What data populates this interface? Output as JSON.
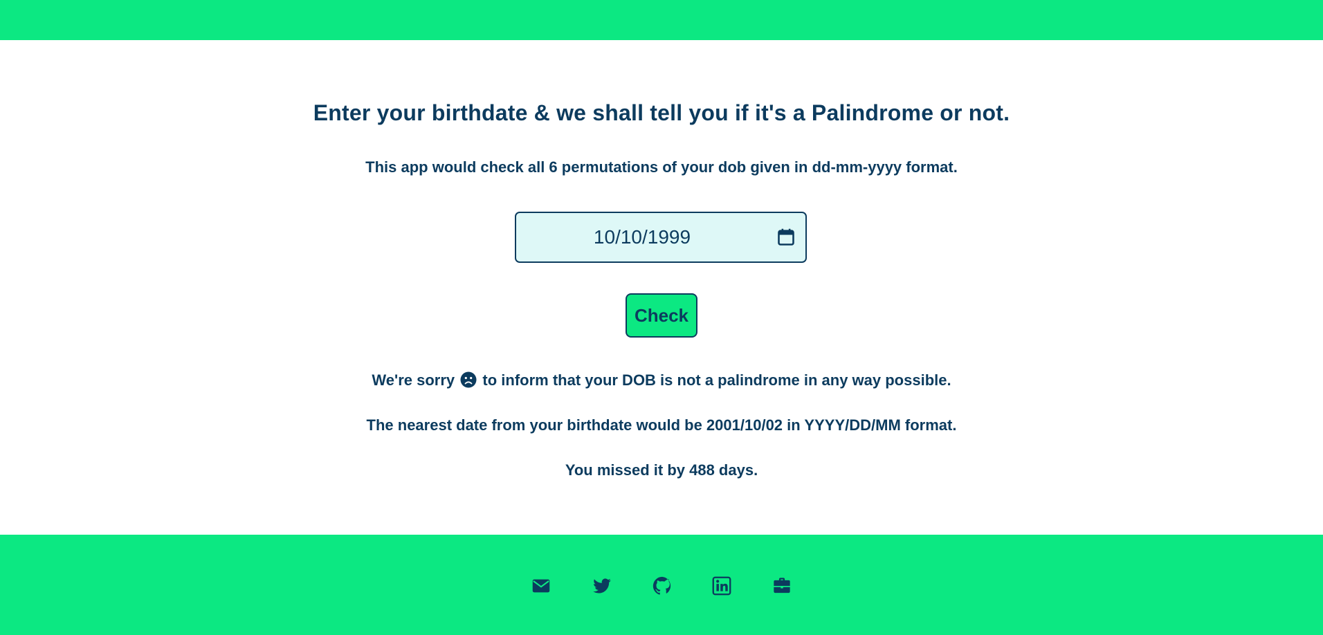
{
  "header": {
    "color": "#0ce882"
  },
  "main": {
    "title": "Enter your birthdate & we shall tell you if it's a Palindrome or not.",
    "subtitle": "This app would check all 6 permutations of your dob given in dd-mm-yyyy format.",
    "date_input": {
      "value": "10/10/1999",
      "icon": "calendar-icon"
    },
    "check_button_label": "Check",
    "result": {
      "line1_before": "We're sorry",
      "line1_icon": "sad-face-icon",
      "line1_after": "to inform that your DOB is not a palindrome in any way possible.",
      "line2": "The nearest date from your birthdate would be 2001/10/02 in YYYY/DD/MM format.",
      "line3": "You missed it by 488 days."
    }
  },
  "footer": {
    "links": [
      {
        "icon": "mail-icon"
      },
      {
        "icon": "twitter-icon"
      },
      {
        "icon": "github-icon"
      },
      {
        "icon": "linkedin-icon"
      },
      {
        "icon": "briefcase-icon"
      }
    ]
  },
  "colors": {
    "accent": "#0ce882",
    "text": "#0c3b5e",
    "input_bg": "#def8f7"
  }
}
